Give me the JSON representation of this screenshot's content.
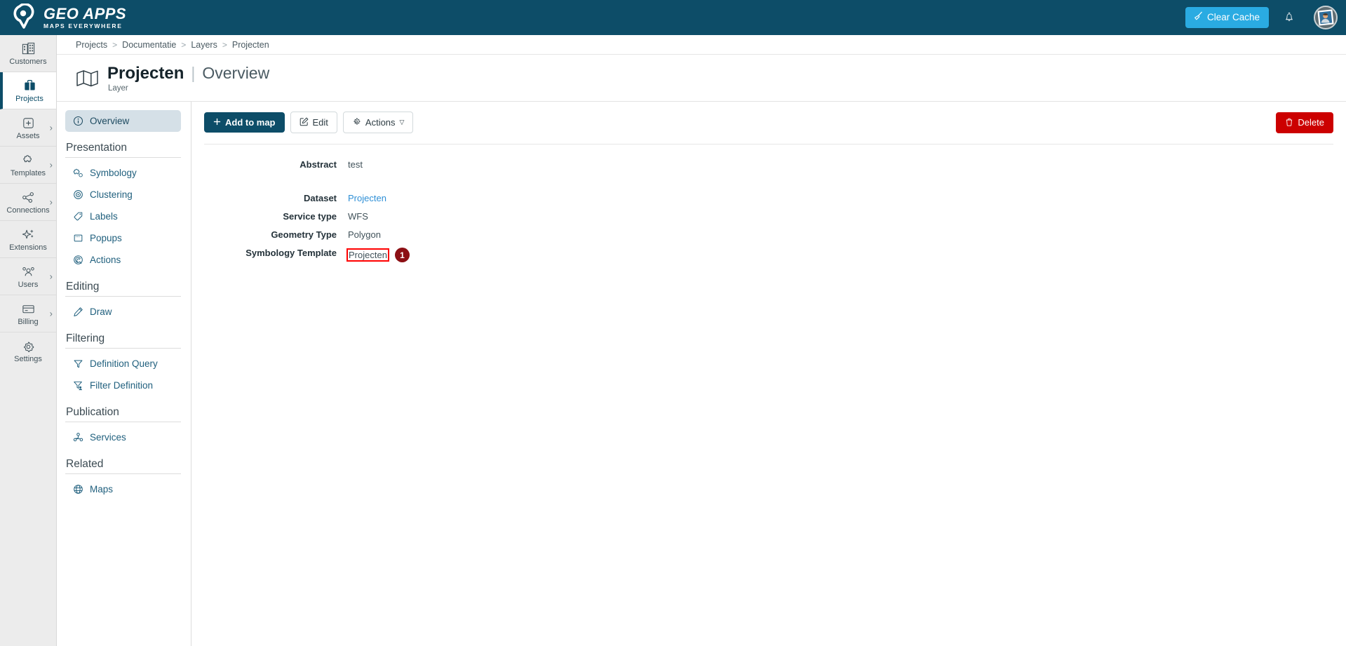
{
  "brand": {
    "title": "GEO APPS",
    "subtitle": "MAPS EVERYWHERE",
    "logo_icon": "map-pin-logo-icon"
  },
  "topbar": {
    "clear_cache_label": "Clear Cache",
    "clear_cache_icon": "broom-icon",
    "clear_cache_color": "#2aabe2",
    "bell_icon": "notification-bell-icon",
    "avatar_icon": "user-avatar-icon",
    "background_color": "#0d4d68"
  },
  "rail": {
    "items": [
      {
        "label": "Customers",
        "icon": "buildings-icon",
        "active": false,
        "expandable": false
      },
      {
        "label": "Projects",
        "icon": "briefcase-icon",
        "active": true,
        "expandable": false
      },
      {
        "label": "Assets",
        "icon": "plus-square-icon",
        "active": false,
        "expandable": true
      },
      {
        "label": "Templates",
        "icon": "puzzle-icon",
        "active": false,
        "expandable": true
      },
      {
        "label": "Connections",
        "icon": "share-nodes-icon",
        "active": false,
        "expandable": true
      },
      {
        "label": "Extensions",
        "icon": "sparkle-icon",
        "active": false,
        "expandable": false
      },
      {
        "label": "Users",
        "icon": "users-icon",
        "active": false,
        "expandable": true
      },
      {
        "label": "Billing",
        "icon": "credit-card-icon",
        "active": false,
        "expandable": true
      },
      {
        "label": "Settings",
        "icon": "gear-icon",
        "active": false,
        "expandable": false
      }
    ]
  },
  "breadcrumb": {
    "separator": ">",
    "items": [
      "Projects",
      "Documentatie",
      "Layers",
      "Projecten"
    ]
  },
  "page": {
    "icon": "map-folded-icon",
    "title": "Projecten",
    "divider": "|",
    "section": "Overview",
    "subtitle": "Layer"
  },
  "sidenav": {
    "overview": {
      "label": "Overview",
      "icon": "info-circle-icon",
      "active": true
    },
    "groups": [
      {
        "title": "Presentation",
        "items": [
          {
            "label": "Symbology",
            "icon": "symbology-icon"
          },
          {
            "label": "Clustering",
            "icon": "cluster-target-icon"
          },
          {
            "label": "Labels",
            "icon": "tag-icon"
          },
          {
            "label": "Popups",
            "icon": "popup-window-icon"
          },
          {
            "label": "Actions",
            "icon": "actions-swirl-icon"
          }
        ]
      },
      {
        "title": "Editing",
        "items": [
          {
            "label": "Draw",
            "icon": "pencil-icon"
          }
        ]
      },
      {
        "title": "Filtering",
        "items": [
          {
            "label": "Definition Query",
            "icon": "funnel-icon"
          },
          {
            "label": "Filter Definition",
            "icon": "funnel-user-icon"
          }
        ]
      },
      {
        "title": "Publication",
        "items": [
          {
            "label": "Services",
            "icon": "services-nodes-icon"
          }
        ]
      },
      {
        "title": "Related",
        "items": [
          {
            "label": "Maps",
            "icon": "globe-icon"
          }
        ]
      }
    ]
  },
  "toolbar": {
    "add_to_map_label": "Add to map",
    "add_to_map_icon": "plus-icon",
    "edit_label": "Edit",
    "edit_icon": "pencil-square-icon",
    "actions_label": "Actions",
    "actions_icon": "gear-icon",
    "actions_caret": "chevron-down-icon",
    "delete_label": "Delete",
    "delete_icon": "trash-icon",
    "primary_color": "#0d4d68",
    "danger_color": "#cc0000"
  },
  "details": {
    "abstract": {
      "label": "Abstract",
      "value": "test"
    },
    "dataset": {
      "label": "Dataset",
      "value": "Projecten",
      "is_link": true
    },
    "service_type": {
      "label": "Service type",
      "value": "WFS"
    },
    "geometry_type": {
      "label": "Geometry Type",
      "value": "Polygon"
    },
    "symbology_template": {
      "label": "Symbology Template",
      "value": "Projecten",
      "is_link": true,
      "highlighted": true,
      "highlight_color": "#ff0000",
      "step_number": "1",
      "step_badge_color": "#8c0f14"
    }
  }
}
